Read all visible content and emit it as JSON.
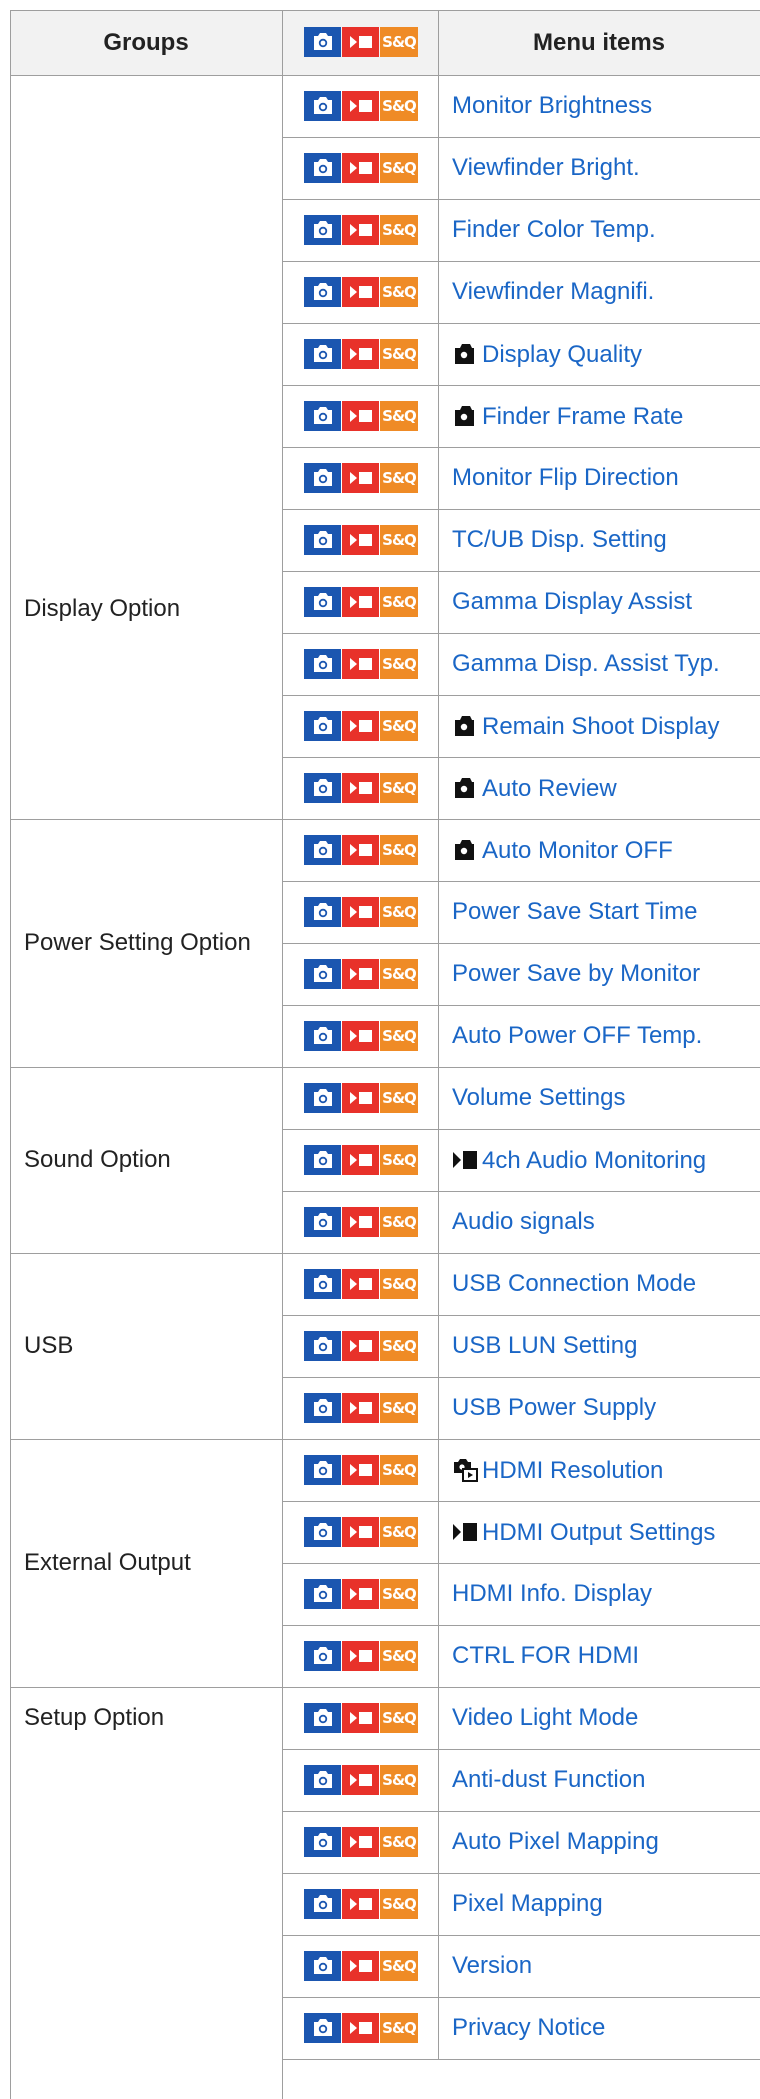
{
  "header": {
    "groups": "Groups",
    "icons_sq": "S&Q",
    "menu_items": "Menu items"
  },
  "mode_icons": {
    "photo": "camera-icon",
    "movie": "movie-icon",
    "sq": "S&Q",
    "colors": {
      "photo": "#1b56b0",
      "movie": "#e8312a",
      "sq": "#ef8b26",
      "link": "#1a66c6"
    }
  },
  "groups": [
    {
      "label": "Display Option"
    },
    {
      "label": "Power Setting Option"
    },
    {
      "label": "Sound Option"
    },
    {
      "label": "USB"
    },
    {
      "label": "External Output"
    },
    {
      "label": "Setup Option"
    }
  ],
  "items": [
    {
      "label": "Monitor Brightness"
    },
    {
      "label": "Viewfinder Bright."
    },
    {
      "label": "Finder Color Temp."
    },
    {
      "label": "Viewfinder Magnifi."
    },
    {
      "label": "Display Quality",
      "icon": "still-camera-icon"
    },
    {
      "label": "Finder Frame Rate",
      "icon": "still-camera-icon"
    },
    {
      "label": "Monitor Flip Direction"
    },
    {
      "label": "TC/UB Disp. Setting"
    },
    {
      "label": "Gamma Display Assist"
    },
    {
      "label": "Gamma Disp. Assist Typ."
    },
    {
      "label": "Remain Shoot Display",
      "icon": "still-camera-icon"
    },
    {
      "label": "Auto Review",
      "icon": "still-camera-icon"
    },
    {
      "label": "Auto Monitor OFF",
      "icon": "still-camera-icon"
    },
    {
      "label": "Power Save Start Time"
    },
    {
      "label": "Power Save by Monitor"
    },
    {
      "label": "Auto Power OFF Temp."
    },
    {
      "label": "Volume Settings"
    },
    {
      "label": "4ch Audio Monitoring",
      "icon": "movie-mode-icon"
    },
    {
      "label": "Audio signals"
    },
    {
      "label": "USB Connection Mode"
    },
    {
      "label": "USB LUN Setting"
    },
    {
      "label": "USB Power Supply"
    },
    {
      "label": "HDMI Resolution",
      "icon": "camera-playback-icon"
    },
    {
      "label": "HDMI Output Settings",
      "icon": "movie-mode-icon"
    },
    {
      "label": "HDMI Info. Display"
    },
    {
      "label": "CTRL FOR HDMI"
    },
    {
      "label": "Video Light Mode"
    },
    {
      "label": "Anti-dust Function"
    },
    {
      "label": "Auto Pixel Mapping"
    },
    {
      "label": "Pixel Mapping"
    },
    {
      "label": "Version"
    },
    {
      "label": "Privacy Notice"
    }
  ]
}
